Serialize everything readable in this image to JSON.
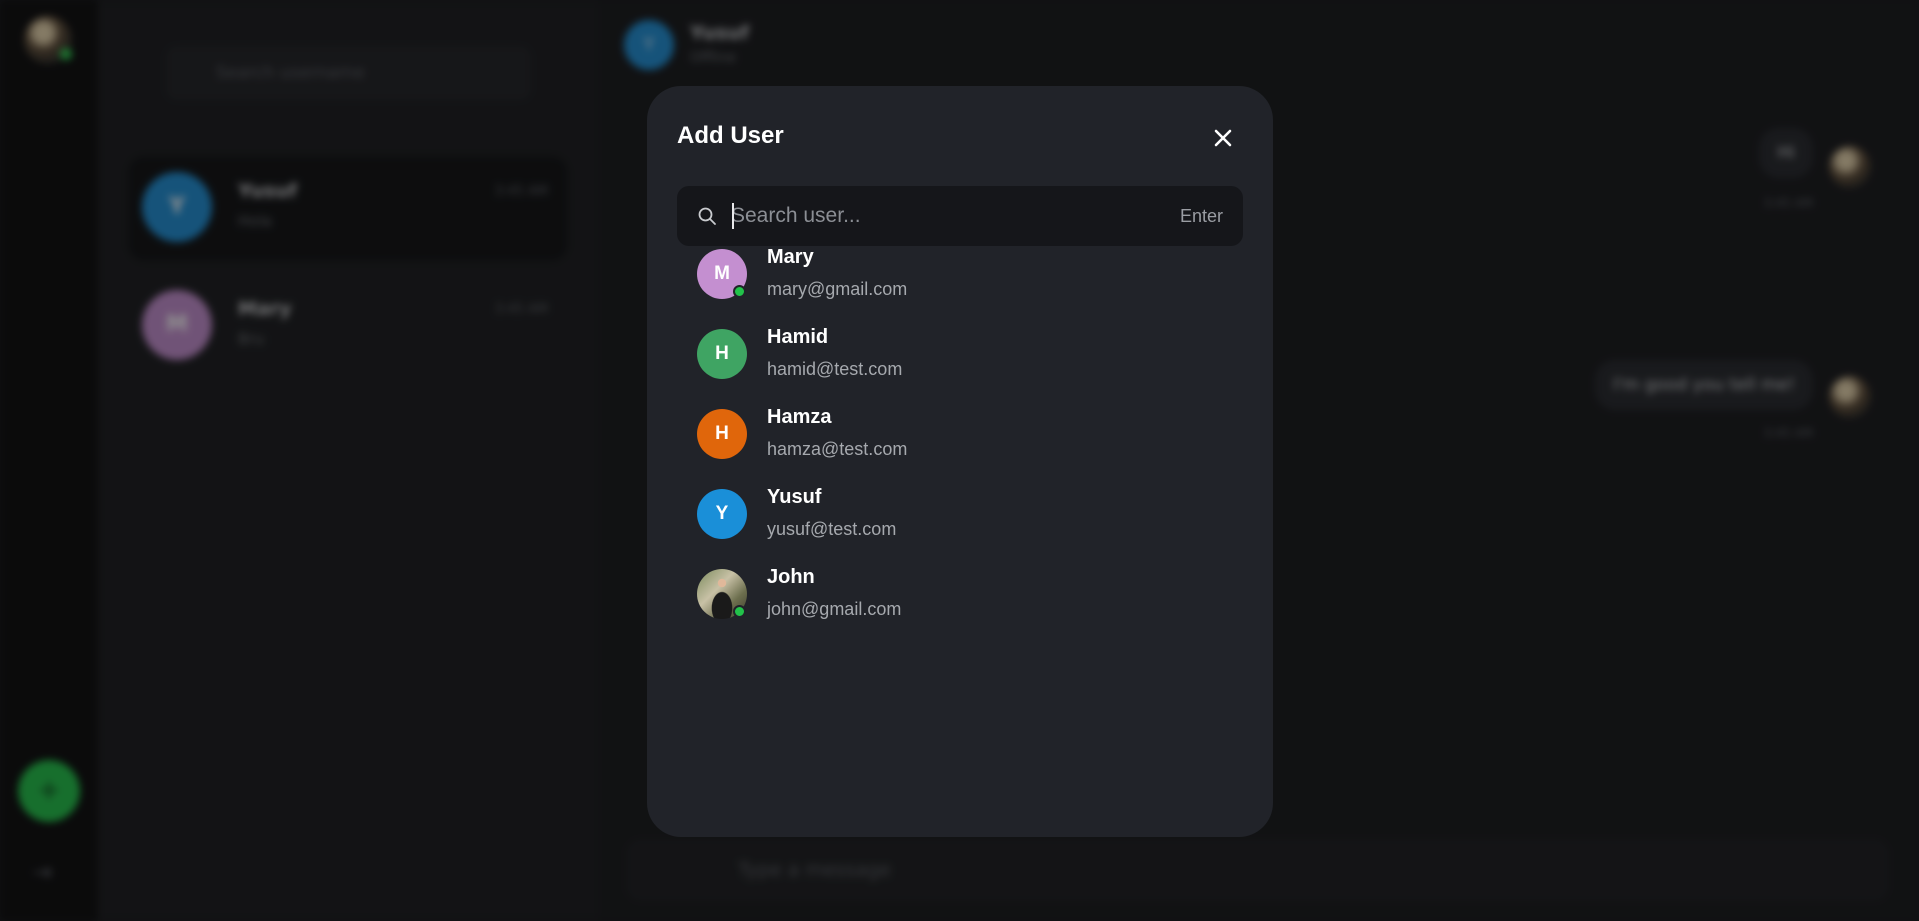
{
  "background": {
    "list_search_placeholder": "Search username",
    "conversations": [
      {
        "initial": "Y",
        "name": "Yusuf",
        "message": "Hola",
        "time": "3:45 AM",
        "color": "#1f8fd6"
      },
      {
        "initial": "M",
        "name": "Mary",
        "message": "Bru",
        "time": "3:45 AM",
        "color": "#c48fd0"
      }
    ],
    "chat_header": {
      "initial": "Y",
      "name": "Yusuf",
      "status": "Offline"
    },
    "messages": [
      {
        "text": "Hi",
        "time": "3:45 AM"
      },
      {
        "text": "I'm good you tell me!",
        "time": "3:45 AM"
      }
    ],
    "composer_placeholder": "Type a message"
  },
  "modal": {
    "title": "Add User",
    "search_placeholder": "Search user...",
    "enter_hint": "Enter",
    "users": [
      {
        "initial": "M",
        "name": "Mary",
        "email": "mary@gmail.com",
        "color": "#c48fd0",
        "online": true
      },
      {
        "initial": "H",
        "name": "Hamid",
        "email": "hamid@test.com",
        "color": "#3fa463",
        "online": false
      },
      {
        "initial": "H",
        "name": "Hamza",
        "email": "hamza@test.com",
        "color": "#e0660b",
        "online": false
      },
      {
        "initial": "Y",
        "name": "Yusuf",
        "email": "yusuf@test.com",
        "color": "#1a8fd8",
        "online": false
      },
      {
        "initial": "",
        "name": "John",
        "email": "john@gmail.com",
        "color": "photo",
        "online": true
      }
    ]
  }
}
